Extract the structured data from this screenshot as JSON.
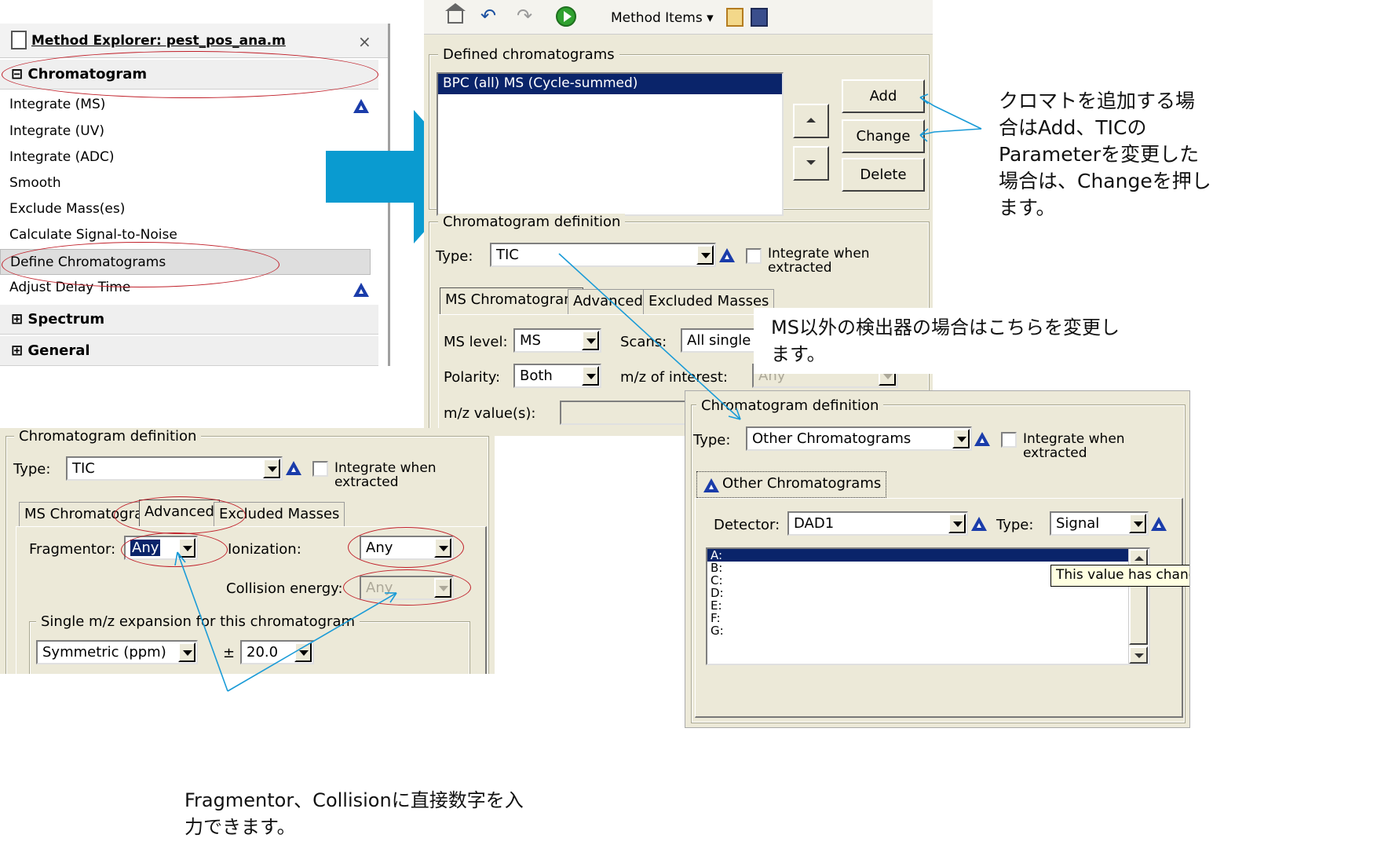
{
  "method_explorer": {
    "title": "Method Explorer: pest_pos_ana.m",
    "close_glyph": "×",
    "sections": {
      "chromatogram": "Chromatogram",
      "spectrum": "Spectrum",
      "general": "General"
    },
    "items": [
      "Integrate (MS)",
      "Integrate (UV)",
      "Integrate (ADC)",
      "Smooth",
      "Exclude Mass(es)",
      "Calculate Signal-to-Noise",
      "Define Chromatograms",
      "Adjust Delay Time"
    ],
    "expand_glyph": "⊞",
    "collapse_glyph": "⊟"
  },
  "toolbar": {
    "method_items": "Method Items ▾"
  },
  "defined": {
    "legend": "Defined chromatograms",
    "list_item": "BPC (all) MS (Cycle-summed)",
    "add": "Add",
    "change": "Change",
    "delete": "Delete"
  },
  "definition_main": {
    "legend": "Chromatogram definition",
    "type_label": "Type:",
    "type_value": "TIC",
    "integrate_label": "Integrate when\nextracted",
    "tabs": [
      "MS Chromatogram",
      "Advanced",
      "Excluded Masses"
    ],
    "ms_level_label": "MS level:",
    "ms_level_value": "MS",
    "scans_label": "Scans:",
    "scans_value": "All single sta",
    "polarity_label": "Polarity:",
    "polarity_value": "Both",
    "mz_interest_label": "m/z of interest:",
    "mz_interest_value": "Any",
    "mz_values_label": "m/z value(s):"
  },
  "definition_advanced": {
    "legend": "Chromatogram definition",
    "type_label": "Type:",
    "type_value": "TIC",
    "integrate_label": "Integrate when\nextracted",
    "tabs": [
      "MS Chromatogram",
      "Advanced",
      "Excluded Masses"
    ],
    "fragmentor_label": "Fragmentor:",
    "fragmentor_value": "Any",
    "ionization_label": "Ionization:",
    "ionization_value": "Any",
    "collision_label": "Collision energy:",
    "collision_value": "Any",
    "expansion_legend": "Single m/z expansion for this chromatogram",
    "expansion_value": "Symmetric (ppm)",
    "plusminus": "±",
    "expansion_amount": "20.0"
  },
  "definition_other": {
    "legend": "Chromatogram definition",
    "type_label": "Type:",
    "type_value": "Other Chromatograms",
    "integrate_label": "Integrate when\nextracted",
    "tab": "Other Chromatograms",
    "detector_label": "Detector:",
    "detector_value": "DAD1",
    "type2_label": "Type:",
    "type2_value": "Signal",
    "signals": [
      "A:",
      "B:",
      "C:",
      "D:",
      "E:",
      "F:",
      "G:"
    ],
    "tooltip": "This value has chang"
  },
  "annotations": {
    "add_change": "クロマトを追加する場\n合はAdd、TICの\nParameterを変更した\n場合は、Changeを押し\nます。",
    "other_detector": "MS以外の検出器の場合はこちらを変更し\nます。",
    "fragmentor": "Fragmentor、Collisionに直接数字を入\n力できます。"
  },
  "colors": {
    "arrow": "#0a9bd0",
    "callout": "#1a9bd7",
    "oval": "#c0202a",
    "selection": "#0a246a",
    "dialog": "#ece9d8"
  }
}
